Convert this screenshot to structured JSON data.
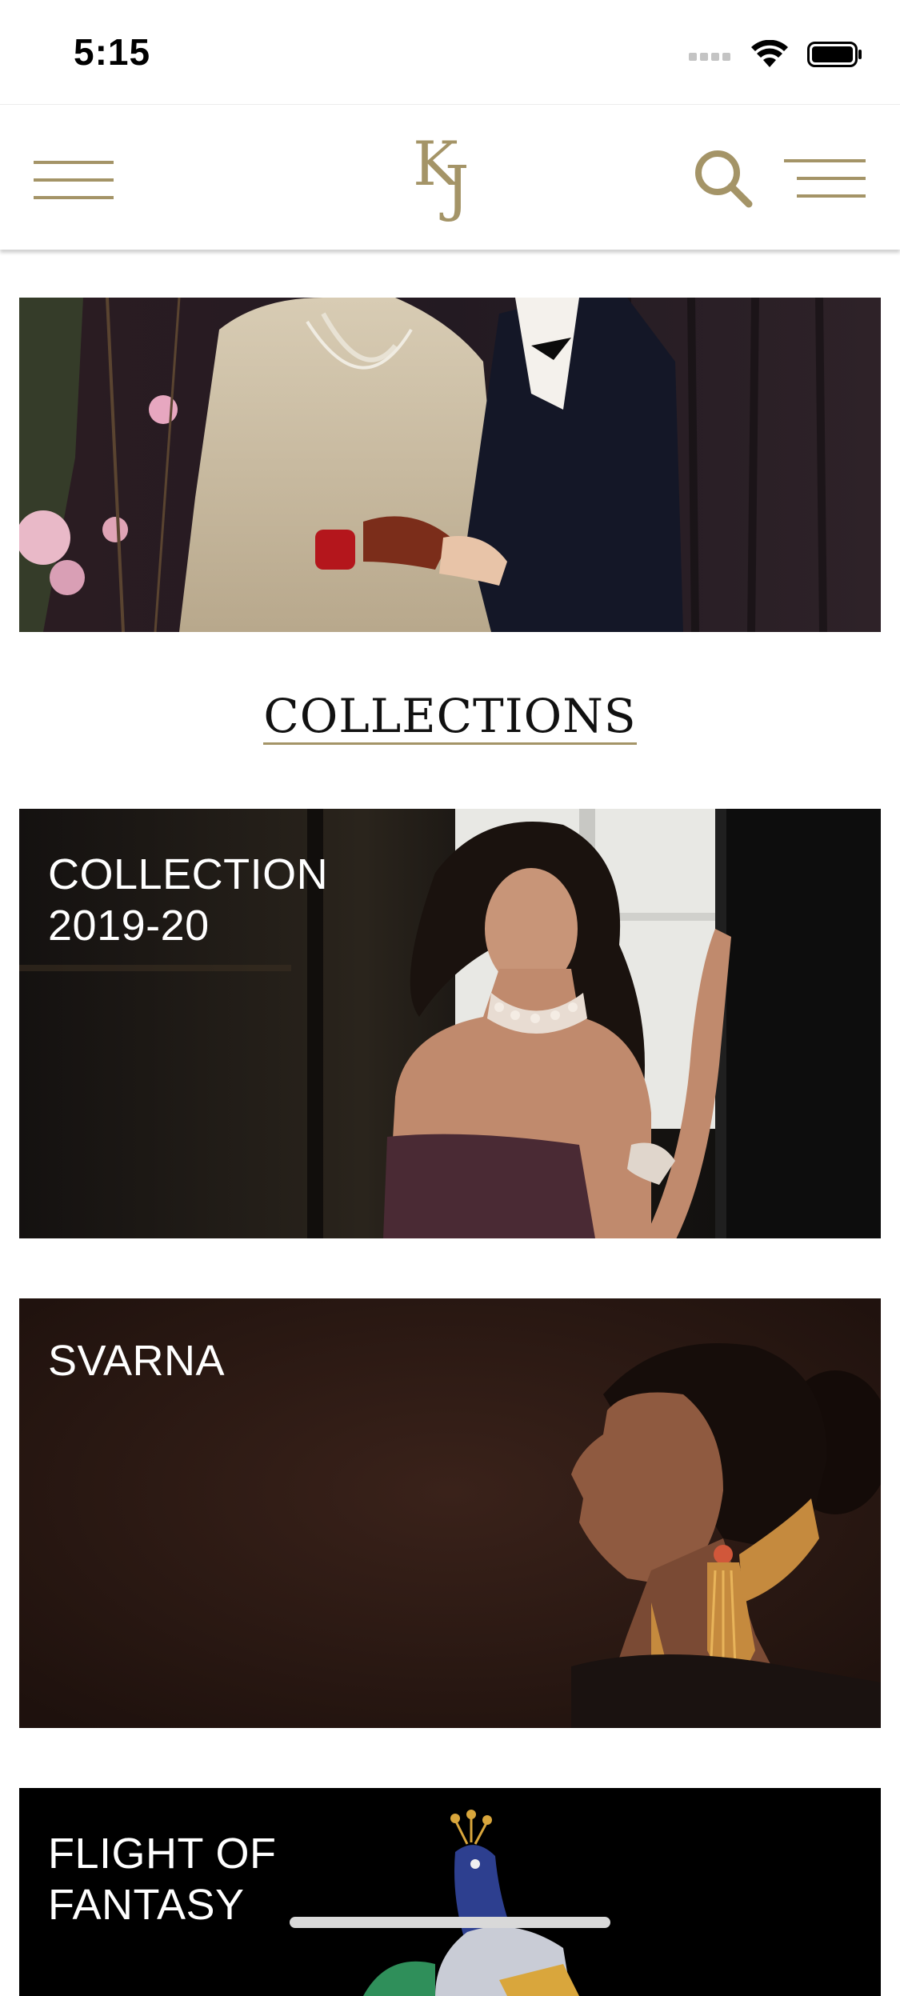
{
  "status_bar": {
    "time": "5:15",
    "icons": [
      "signal-icon",
      "wifi-icon",
      "battery-icon"
    ]
  },
  "header": {
    "logo_text": "KJ",
    "menu_icon": "hamburger-menu-icon",
    "search_icon": "search-icon",
    "filter_icon": "filter-menu-icon"
  },
  "hero": {
    "image": "bridal-couple-photo"
  },
  "collections": {
    "title": "COLLECTIONS",
    "items": [
      {
        "label": "COLLECTION\n2019-20",
        "image": "model-pearl-choker-photo"
      },
      {
        "label": "SVARNA",
        "image": "model-gold-earring-photo"
      },
      {
        "label": "FLIGHT OF\nFANTASY",
        "image": "peacock-brooch-photo"
      }
    ]
  },
  "colors": {
    "brand_gold": "#a49467",
    "text_dark": "#111111",
    "background": "#ffffff"
  }
}
